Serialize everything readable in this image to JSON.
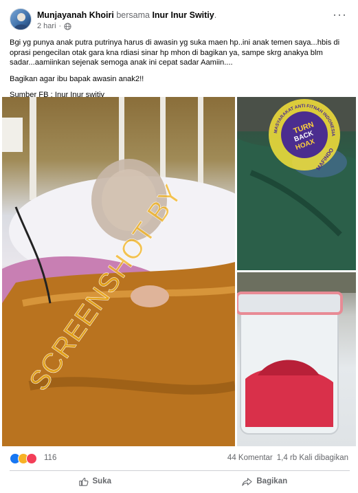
{
  "header": {
    "author": "Munjayanah Khoiri",
    "with_text": "bersama",
    "tagged": "Inur Inur Switiy",
    "timestamp": "2 hari",
    "more_label": "···"
  },
  "post": {
    "paragraph1": "Bgi yg punya anak putra putrinya harus di awasin yg suka maen hp..ini anak temen saya...hbis di oprasi pengecilan otak gara kna rdiasi sinar hp mhon di bagikan ya, sampe skrg anakya blm sadar...aamiinkan sejenak semoga anak ini cepat sadar Aamiin....",
    "paragraph2": "Bagikan agar ibu bapak awasin anak2!!",
    "paragraph3": "Sumber FB : Inur Inur switiy"
  },
  "watermarks": {
    "diagonal_text": "SCREENSHOT BY",
    "badge_line1": "TURN",
    "badge_line2": "BACK",
    "badge_line3": "HOAX",
    "badge_ring": "MASYARAKAT ANTI FITNAH INDONESIA",
    "badge_bottom": "MAFINDO"
  },
  "reactions": {
    "count": "116",
    "comments": "44 Komentar",
    "shares": "1,4 rb Kali dibagikan",
    "like_color": "#1877f2",
    "sad_color": "#f7b125",
    "love_color": "#f33e58"
  },
  "actions": {
    "like": "Suka",
    "share": "Bagikan"
  }
}
